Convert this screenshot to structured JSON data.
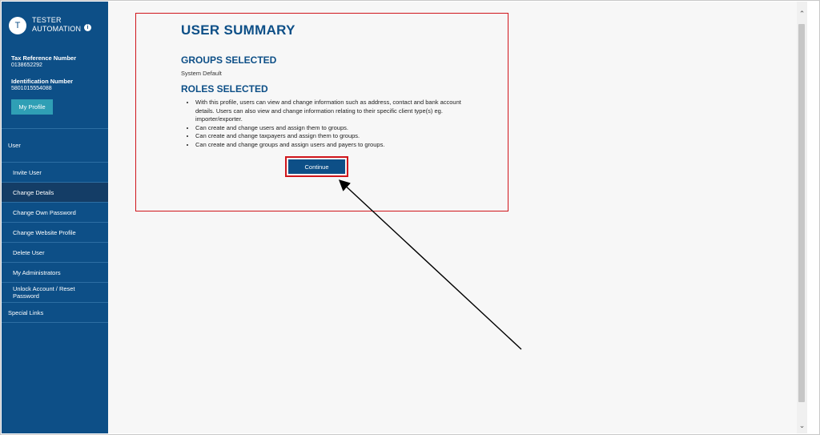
{
  "user": {
    "avatar_initial": "T",
    "name_line1": "TESTER",
    "name_line2": "AUTOMATION",
    "info_icon": "i",
    "tax_ref_label": "Tax Reference Number",
    "tax_ref_value": "0138652292",
    "id_label": "Identification Number",
    "id_value": "5801015554088",
    "profile_button": "My Profile"
  },
  "nav": {
    "items": [
      {
        "label": "User",
        "type": "section"
      },
      {
        "label": "Invite User",
        "type": "sub"
      },
      {
        "label": "Change Details",
        "type": "sub",
        "active": true
      },
      {
        "label": "Change Own Password",
        "type": "sub"
      },
      {
        "label": "Change Website Profile",
        "type": "sub"
      },
      {
        "label": "Delete User",
        "type": "sub"
      },
      {
        "label": "My Administrators",
        "type": "sub"
      },
      {
        "label": "Unlock Account / Reset Password",
        "type": "sub"
      },
      {
        "label": "Special Links",
        "type": "section"
      }
    ]
  },
  "summary": {
    "title": "USER SUMMARY",
    "groups_heading": "GROUPS SELECTED",
    "groups_value": "System Default",
    "roles_heading": "ROLES SELECTED",
    "roles": [
      "With this profile, users can view and change information such as address, contact and bank account details. Users can also view and change information relating to their specific client type(s) eg. importer/exporter.",
      "Can create and change users and assign them to groups.",
      "Can create and change taxpayers and assign them to groups.",
      "Can create and change groups and assign users and payers to groups."
    ],
    "continue_button": "Continue"
  },
  "scrollbar": {
    "up_icon": "⌃",
    "down_icon": "⌄"
  },
  "colors": {
    "sidebar": "#0d4f87",
    "highlight": "#d0161c",
    "accent_button": "#2f9fb5"
  }
}
